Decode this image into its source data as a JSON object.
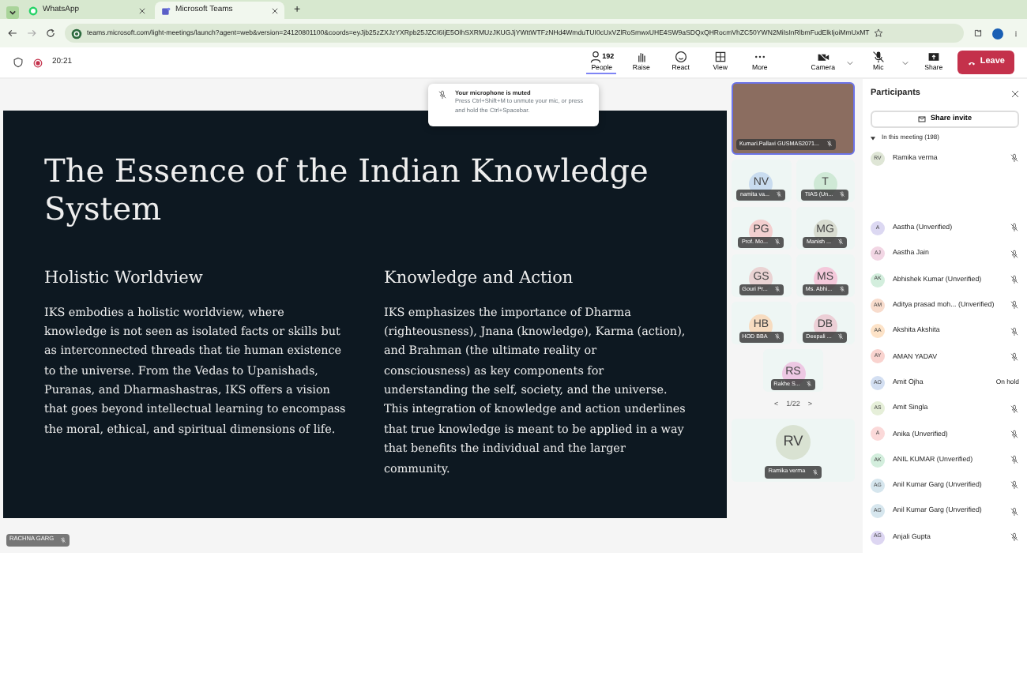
{
  "browser": {
    "tabs": [
      {
        "title": "WhatsApp",
        "kind": "whatsapp",
        "selected": false
      },
      {
        "title": "Microsoft Teams",
        "kind": "teams",
        "selected": true
      }
    ],
    "new_tab": "+",
    "url": "teams.microsoft.com/light-meetings/launch?agent=web&version=24120801100&coords=eyJjb25zZXJzYXRpb25JZCI6IjE5OlhSXRMUzJKUGJjYWttWTFzNHd4WmduTUI0cUxVZlRoSmwxUHE4SW9aSDQxQHRocmVhZC50YWN2MiIsInRlbmFudElkIjoiMmUxMT"
  },
  "meeting_bar": {
    "time": "20:21",
    "people_count": "192",
    "actions": [
      {
        "label": "People",
        "kind": "people",
        "selected": true
      },
      {
        "label": "Raise",
        "kind": "raise",
        "selected": false
      },
      {
        "label": "React",
        "kind": "react",
        "selected": false
      },
      {
        "label": "View",
        "kind": "view",
        "selected": false
      },
      {
        "label": "More",
        "kind": "more",
        "selected": false
      }
    ],
    "devices": [
      {
        "label": "Camera",
        "kind": "camera"
      },
      {
        "label": "Mic",
        "kind": "mic"
      },
      {
        "label": "Share",
        "kind": "share"
      }
    ],
    "leave": "Leave"
  },
  "toast": {
    "title": "Your microphone is muted",
    "message": "Press Ctrl+Shift+M to unmute your mic, or press and hold the Ctrl+Spacebar."
  },
  "slide": {
    "title": "The Essence of the Indian Knowledge System",
    "columns": [
      {
        "heading": "Holistic Worldview",
        "text": "IKS embodies a holistic worldview, where knowledge is not seen as isolated facts or skills but as interconnected threads that tie human existence to the universe. From the Vedas to Upanishads, Puranas, and Dharmashastras, IKS offers a vision that goes beyond intellectual learning to encompass the moral, ethical, and spiritual dimensions of life."
      },
      {
        "heading": "Knowledge and Action",
        "text": "IKS emphasizes the importance of Dharma (righteousness), Jnana (knowledge), Karma (action), and Brahman (the ultimate reality or consciousness) as key components for understanding the self, society, and the universe. This integration of knowledge and action underlines that true knowledge is meant to be applied in a way that benefits the individual and the larger community."
      }
    ]
  },
  "presenter": "RACHNA GARG",
  "featured": {
    "name": "Kumari.Pallavi GUSMAS2071..."
  },
  "tiles": [
    {
      "initials": "NV",
      "name": "namita va...",
      "color": "#c9dcef"
    },
    {
      "initials": "T",
      "name": "TIAS (Un...",
      "color": "#cfe9d6"
    },
    {
      "initials": "PG",
      "name": "Prof. Mo...",
      "color": "#f3cfcf"
    },
    {
      "initials": "MG",
      "name": "Manish ...",
      "color": "#d8dcd0"
    },
    {
      "initials": "GS",
      "name": "Gouri Pr...",
      "color": "#ead3d3"
    },
    {
      "initials": "MS",
      "name": "Ms. Abhi...",
      "color": "#f4c9db"
    },
    {
      "initials": "HB",
      "name": "HOD BBA",
      "color": "#f7dcc0"
    },
    {
      "initials": "DB",
      "name": "Deepali ...",
      "color": "#eccfd6"
    },
    {
      "initials": "RS",
      "name": "Rakhe S...",
      "color": "#edc8e3"
    }
  ],
  "pager": {
    "prev": "<",
    "page": "1/22",
    "next": ">"
  },
  "self_tile": {
    "initials": "RV",
    "name": "Ramika verma",
    "color": "#d9e2d2"
  },
  "participants": {
    "title": "Participants",
    "share_invite": "Share invite",
    "section": "In this meeting (198)",
    "people": [
      {
        "initials": "RV",
        "name": "Ramika verma",
        "color": "#dfe6d6",
        "kind": "muted",
        "gap_after": true
      },
      {
        "initials": "A",
        "name": "Aastha (Unverified)",
        "color": "#dcd8f2",
        "kind": "muted"
      },
      {
        "initials": "AJ",
        "name": "Aastha Jain",
        "color": "#f2d6e4",
        "kind": "muted"
      },
      {
        "initials": "AK",
        "name": "Abhishek Kumar (Unverified)",
        "color": "#d3eedd",
        "kind": "muted"
      },
      {
        "initials": "AM",
        "name": "Aditya prasad moh... (Unverified)",
        "color": "#f8dccd",
        "kind": "muted"
      },
      {
        "initials": "AA",
        "name": "Akshita Akshita",
        "color": "#fde3c8",
        "kind": "muted"
      },
      {
        "initials": "AY",
        "name": "AMAN YADAV",
        "color": "#f9d3cf",
        "kind": "muted"
      },
      {
        "initials": "AO",
        "name": "Amit Ojha",
        "color": "#d3dff2",
        "kind": "status",
        "status": "On hold"
      },
      {
        "initials": "AS",
        "name": "Amit Singla",
        "color": "#e6efd9",
        "kind": "muted"
      },
      {
        "initials": "A",
        "name": "Anika (Unverified)",
        "color": "#fbd9d9",
        "kind": "muted"
      },
      {
        "initials": "AK",
        "name": "ANIL KUMAR (Unverified)",
        "color": "#d3eedd",
        "kind": "muted"
      },
      {
        "initials": "AG",
        "name": "Anil Kumar Garg (Unverified)",
        "color": "#d6e6ee",
        "kind": "muted"
      },
      {
        "initials": "AG",
        "name": "Anil Kumar Garg (Unverified)",
        "color": "#d6e6ee",
        "kind": "muted"
      },
      {
        "initials": "AG",
        "name": "Anjali Gupta",
        "color": "#ddd6f2",
        "kind": "muted"
      }
    ]
  }
}
